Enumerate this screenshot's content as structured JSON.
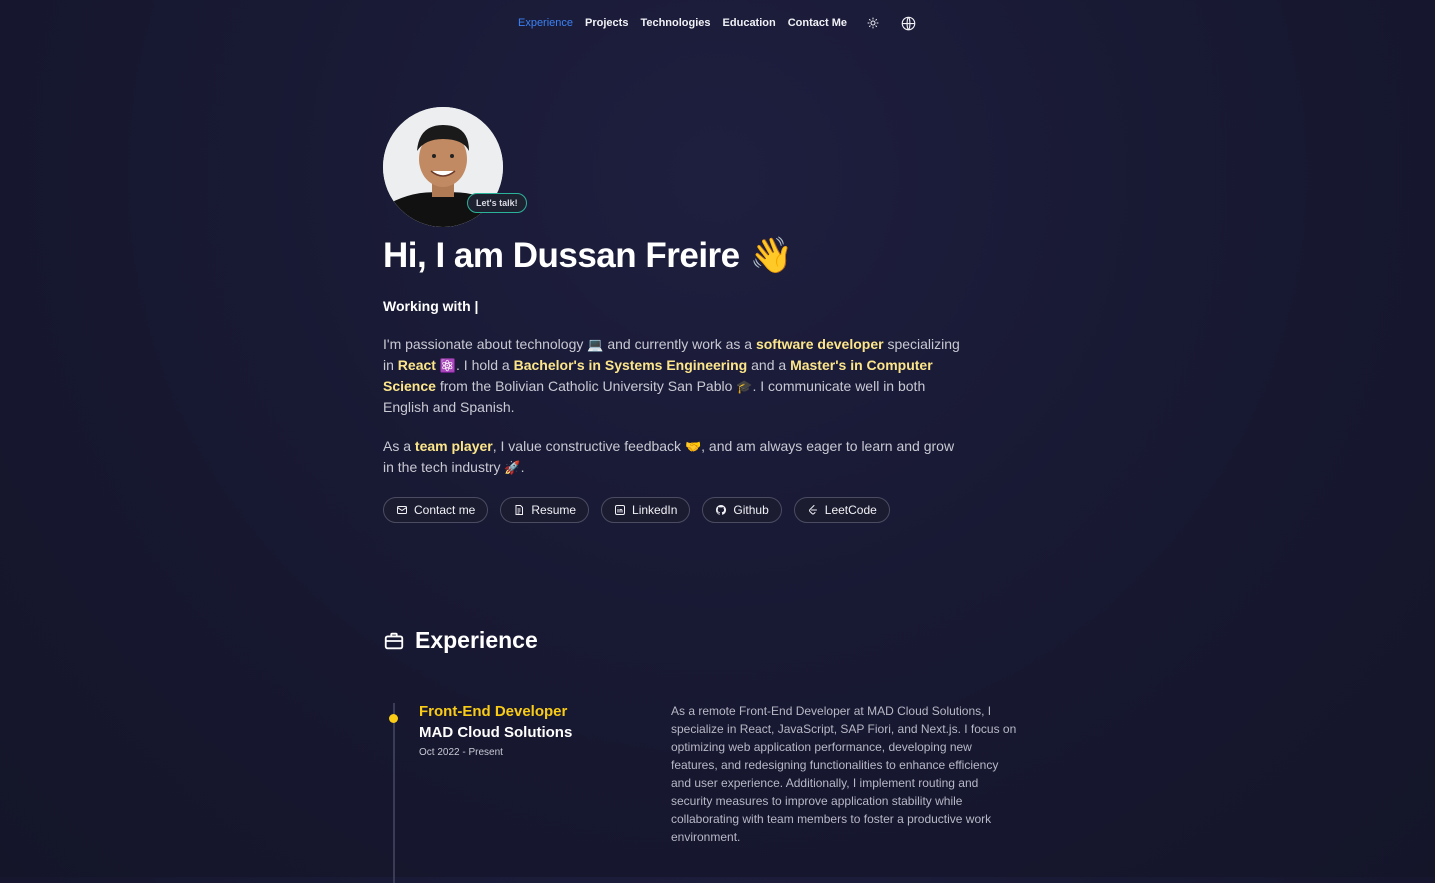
{
  "nav": {
    "items": [
      {
        "label": "Experience",
        "active": true
      },
      {
        "label": "Projects",
        "active": false
      },
      {
        "label": "Technologies",
        "active": false
      },
      {
        "label": "Education",
        "active": false
      },
      {
        "label": "Contact Me",
        "active": false
      }
    ],
    "theme_icon": "sun-icon",
    "language_icon": "globe-icon"
  },
  "hero": {
    "badge": "Let's talk!",
    "title": "Hi, I am Dussan Freire",
    "title_emoji": "👋",
    "typing_text": "Working with |",
    "p1": {
      "t1": "I'm passionate about technology ",
      "e1": "💻",
      "t2": " and currently work as a ",
      "h1": "software developer",
      "t3": " specializing in ",
      "h2": "React",
      "e2": "⚛️",
      "t4": ". I hold a ",
      "h3": "Bachelor's in Systems Engineering",
      "t5": " and a ",
      "h4": "Master's in Computer Science",
      "t6": " from the Bolivian Catholic University San Pablo ",
      "e3": "🎓",
      "t7": ". I communicate well in both English and Spanish."
    },
    "p2": {
      "t1": "As a ",
      "h1": "team player",
      "t2": ", I value constructive feedback ",
      "e1": "🤝",
      "t3": ", and am always eager to learn and grow in the tech industry ",
      "e2": "🚀",
      "t4": "."
    },
    "buttons": [
      {
        "label": "Contact me",
        "icon": "mail-icon"
      },
      {
        "label": "Resume",
        "icon": "resume-icon"
      },
      {
        "label": "LinkedIn",
        "icon": "linkedin-icon"
      },
      {
        "label": "Github",
        "icon": "github-icon"
      },
      {
        "label": "LeetCode",
        "icon": "leetcode-icon"
      }
    ]
  },
  "experience": {
    "heading": "Experience",
    "heading_icon": "briefcase-icon",
    "jobs": [
      {
        "role": "Front-End Developer",
        "company": "MAD Cloud Solutions",
        "dates": "Oct 2022 - Present",
        "description": "As a remote Front-End Developer at MAD Cloud Solutions, I specialize in React, JavaScript, SAP Fiori, and Next.js. I focus on optimizing web application performance, developing new features, and redesigning functionalities to enhance efficiency and user experience. Additionally, I implement routing and security measures to improve application stability while collaborating with team members to foster a productive work environment."
      }
    ]
  },
  "colors": {
    "accent_blue": "#3b82f6",
    "highlight": "#fde68a",
    "timeline_yellow": "#facc15",
    "badge_border": "#2bb39a",
    "background": "#181933"
  }
}
